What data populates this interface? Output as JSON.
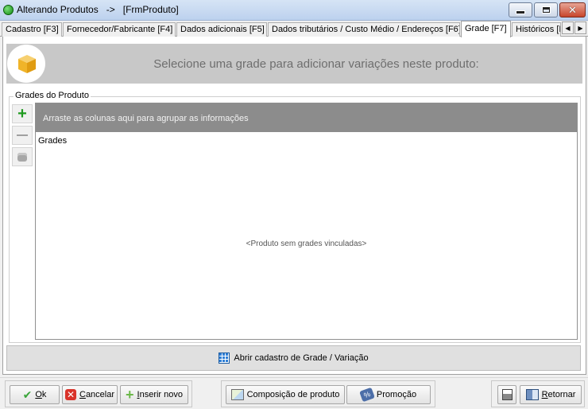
{
  "window": {
    "title": "Alterando Produtos   ->   [FrmProduto]",
    "minimize": "minimize-icon",
    "maximize": "maximize-icon",
    "close": "close-icon"
  },
  "tabs": [
    {
      "label": "Cadastro [F3]",
      "active": false
    },
    {
      "label": "Fornecedor/Fabricante [F4]",
      "active": false
    },
    {
      "label": "Dados adicionais [F5]",
      "active": false
    },
    {
      "label": "Dados tributários / Custo Médio / Endereços [F6]",
      "active": true,
      "note": "not active"
    },
    {
      "label": "Grade [F7]",
      "active": true
    },
    {
      "label": "Históricos [I",
      "active": false
    }
  ],
  "banner": {
    "text": "Selecione uma grade para adicionar variações neste produto:"
  },
  "group": {
    "label": "Grades do Produto",
    "grid": {
      "group_panel_text": "Arraste as colunas aqui para agrupar as informações",
      "column_header": "Grades",
      "empty_text": "<Produto sem grades vinculadas>"
    }
  },
  "open_bar": {
    "label": "Abrir cadastro de Grade / Variação"
  },
  "footer": {
    "ok": "Ok",
    "cancel": "Cancelar",
    "insert": "Inserir novo",
    "composition": "Composição de produto",
    "promotion": "Promoção",
    "return": "Retornar"
  },
  "colors": {
    "banner_bg": "#c8c8c8",
    "group_panel_bg": "#8c8c8c",
    "accent_green": "#1f9a1f"
  }
}
